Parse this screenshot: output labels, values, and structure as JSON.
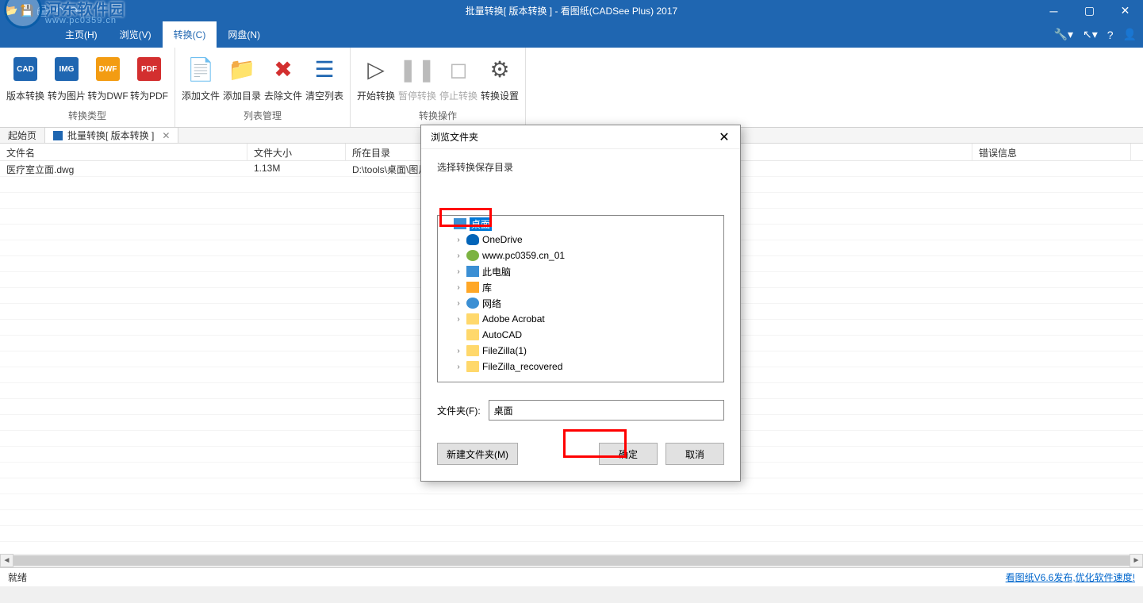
{
  "watermark": {
    "brand": "河东软件园",
    "url": "www.pc0359.cn"
  },
  "titlebar": {
    "title": "批量转换[ 版本转换 ] - 看图纸(CADSee Plus) 2017"
  },
  "menubar": {
    "items": [
      {
        "label": "主页(H)"
      },
      {
        "label": "浏览(V)"
      },
      {
        "label": "转换(C)",
        "active": true
      },
      {
        "label": "网盘(N)"
      }
    ]
  },
  "ribbon": {
    "groups": [
      {
        "title": "转换类型",
        "items": [
          {
            "label": "版本转换",
            "icon": "cad-icon"
          },
          {
            "label": "转为图片",
            "icon": "img-icon"
          },
          {
            "label": "转为DWF",
            "icon": "dwf-icon"
          },
          {
            "label": "转为PDF",
            "icon": "pdf-icon"
          }
        ]
      },
      {
        "title": "列表管理",
        "items": [
          {
            "label": "添加文件",
            "icon": "add-file-icon"
          },
          {
            "label": "添加目录",
            "icon": "add-folder-icon"
          },
          {
            "label": "去除文件",
            "icon": "remove-file-icon"
          },
          {
            "label": "清空列表",
            "icon": "clear-list-icon"
          }
        ]
      },
      {
        "title": "转换操作",
        "items": [
          {
            "label": "开始转换",
            "icon": "play-icon"
          },
          {
            "label": "暂停转换",
            "icon": "pause-icon",
            "disabled": true
          },
          {
            "label": "停止转换",
            "icon": "stop-icon",
            "disabled": true
          },
          {
            "label": "转换设置",
            "icon": "settings-icon"
          }
        ]
      }
    ]
  },
  "tabs": [
    {
      "label": "起始页"
    },
    {
      "label": "批量转换[ 版本转换 ]",
      "active": true,
      "closable": true
    }
  ],
  "table": {
    "headers": {
      "name": "文件名",
      "size": "文件大小",
      "dir": "所在目录",
      "err": "错误信息"
    },
    "rows": [
      {
        "name": "医疗室立面.dwg",
        "size": "1.13M",
        "dir": "D:\\tools\\桌面\\图片素材",
        "err": ""
      }
    ]
  },
  "dialog": {
    "title": "浏览文件夹",
    "label": "选择转换保存目录",
    "tree": [
      {
        "label": "桌面",
        "icon": "desktop",
        "selected": true,
        "indent": 0
      },
      {
        "label": "OneDrive",
        "icon": "onedrive",
        "expandable": true,
        "indent": 1
      },
      {
        "label": "www.pc0359.cn_01",
        "icon": "user",
        "expandable": true,
        "indent": 1
      },
      {
        "label": "此电脑",
        "icon": "pc",
        "expandable": true,
        "indent": 1
      },
      {
        "label": "库",
        "icon": "lib",
        "expandable": true,
        "indent": 1
      },
      {
        "label": "网络",
        "icon": "network",
        "expandable": true,
        "indent": 1
      },
      {
        "label": "Adobe Acrobat",
        "icon": "folder",
        "expandable": true,
        "indent": 1
      },
      {
        "label": "AutoCAD",
        "icon": "folder",
        "indent": 1
      },
      {
        "label": "FileZilla(1)",
        "icon": "folder",
        "expandable": true,
        "indent": 1
      },
      {
        "label": "FileZilla_recovered",
        "icon": "folder",
        "expandable": true,
        "indent": 1
      }
    ],
    "folder_label": "文件夹(F):",
    "folder_value": "桌面",
    "buttons": {
      "new_folder": "新建文件夹(M)",
      "ok": "确定",
      "cancel": "取消"
    }
  },
  "statusbar": {
    "left": "就绪",
    "right": "看图纸V6.6发布,优化软件速度!"
  }
}
